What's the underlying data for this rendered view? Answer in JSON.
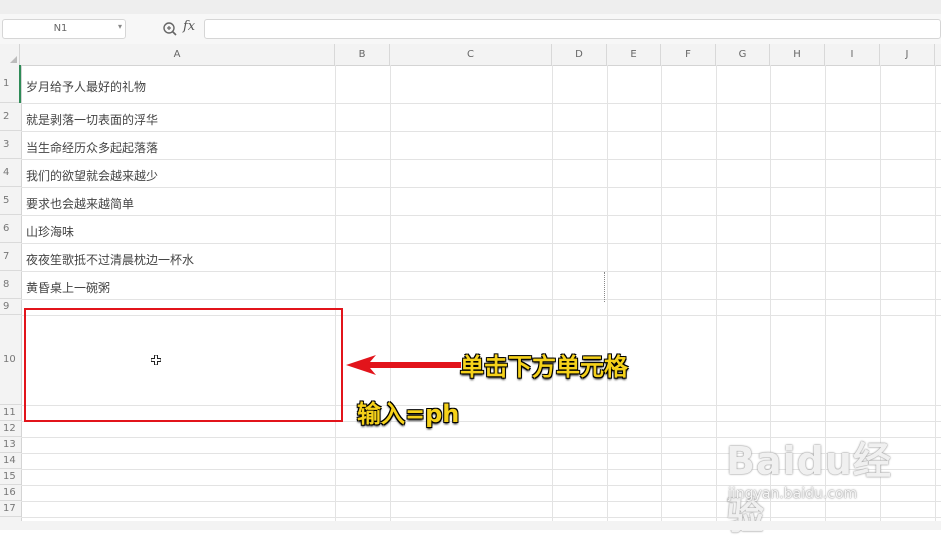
{
  "formula_bar": {
    "name_box": "N1",
    "fx_label": "fx",
    "formula_value": ""
  },
  "columns": [
    "A",
    "B",
    "C",
    "D",
    "E",
    "F",
    "G",
    "H",
    "I",
    "J"
  ],
  "rows": [
    "1",
    "2",
    "3",
    "4",
    "5",
    "6",
    "7",
    "8",
    "9",
    "10",
    "11",
    "12",
    "13",
    "14",
    "15",
    "16",
    "17"
  ],
  "cells_a": [
    "岁月给予人最好的礼物",
    "就是剥落一切表面的浮华",
    "当生命经历众多起起落落",
    "我们的欲望就会越来越少",
    "要求也会越来越简单",
    "山珍海味",
    "夜夜笙歌抵不过清晨枕边一杯水",
    "黄昏桌上一碗粥"
  ],
  "annotations": {
    "instruction_1": "单击下方单元格",
    "instruction_2": "输入=ph"
  },
  "watermark": {
    "logo": "Baidu经验",
    "url": "jingyan.baidu.com"
  },
  "colors": {
    "highlight_box": "#e2141b",
    "annotation_text": "#f5d11a",
    "arrow": "#e2141b"
  }
}
